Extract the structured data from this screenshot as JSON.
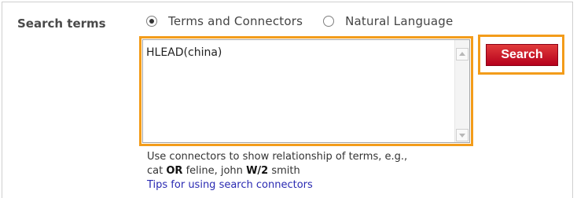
{
  "form": {
    "label": "Search terms",
    "radio_options": [
      {
        "label": "Terms and Connectors",
        "checked": true
      },
      {
        "label": "Natural Language",
        "checked": false
      }
    ],
    "query_value": "HLEAD(china)",
    "search_button_label": "Search"
  },
  "help": {
    "line1": "Use connectors to show relationship of terms, e.g.,",
    "example_cat": "cat",
    "op_or": "OR",
    "example_feline": "feline, john",
    "op_w2": "W/2",
    "example_smith": "smith",
    "tips_link": "Tips for using search connectors"
  },
  "colors": {
    "highlight": "#f39c1a",
    "search_button": "#c8102e",
    "link": "#2a2ab2"
  }
}
